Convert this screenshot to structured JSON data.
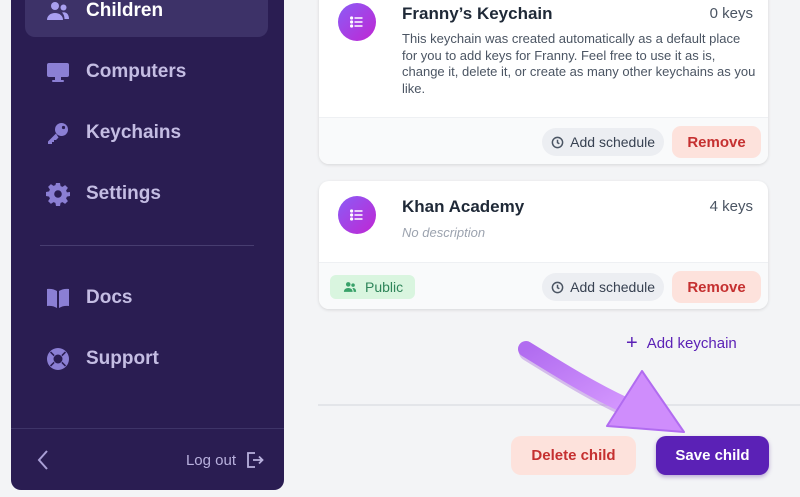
{
  "sidebar": {
    "items": [
      {
        "label": "Children",
        "icon": "users-icon",
        "active": true
      },
      {
        "label": "Computers",
        "icon": "monitor-icon",
        "active": false
      },
      {
        "label": "Keychains",
        "icon": "key-icon",
        "active": false
      },
      {
        "label": "Settings",
        "icon": "gear-icon",
        "active": false
      },
      {
        "label": "Docs",
        "icon": "book-icon",
        "active": false
      },
      {
        "label": "Support",
        "icon": "lifebuoy-icon",
        "active": false
      }
    ],
    "logout_label": "Log out"
  },
  "keychains": [
    {
      "title": "Franny’s Keychain",
      "keys": "0 keys",
      "description": "This keychain was created automatically as a default place for you to add keys for Franny. Feel free to use it as is, change it, delete it, or create as many other keychains as you like.",
      "schedule_label": "Add schedule",
      "remove_label": "Remove"
    },
    {
      "title": "Khan Academy",
      "keys": "4 keys",
      "description": "No description",
      "badge": "Public",
      "schedule_label": "Add schedule",
      "remove_label": "Remove"
    }
  ],
  "add_keychain_label": "Add keychain",
  "actions": {
    "delete_label": "Delete child",
    "save_label": "Save child"
  },
  "colors": {
    "sidebar_bg": "#2a1d52",
    "accent": "#5b21b6",
    "danger": "#c53030",
    "annotation_arrow": "#c77dff"
  }
}
